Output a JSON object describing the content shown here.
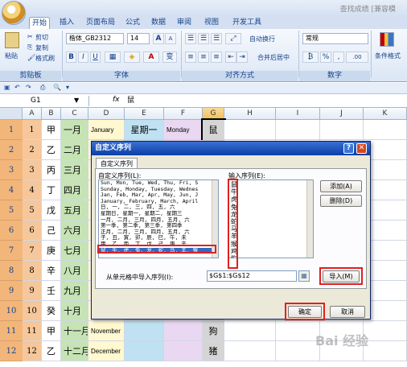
{
  "window": {
    "title": "查找成绩 [兼容模"
  },
  "tabs": [
    {
      "label": "开始",
      "active": true
    },
    {
      "label": "插入"
    },
    {
      "label": "页面布局"
    },
    {
      "label": "公式"
    },
    {
      "label": "数据"
    },
    {
      "label": "审阅"
    },
    {
      "label": "视图"
    },
    {
      "label": "开发工具"
    }
  ],
  "ribbon": {
    "clipboard": {
      "paste": "粘贴",
      "cut": "剪切",
      "copy": "复制",
      "format_painter": "格式刷",
      "label": "剪贴板"
    },
    "font": {
      "name": "楷体_GB2312",
      "size": "14",
      "grow": "A",
      "shrink": "A",
      "bold": "B",
      "italic": "I",
      "underline": "U",
      "wen": "变",
      "label": "字体"
    },
    "alignment": {
      "wrap": "自动换行",
      "merge": "合并后居中",
      "label": "对齐方式"
    },
    "number": {
      "format": "常规",
      "percent": "%",
      "comma": ",",
      "label": "数字"
    },
    "styles": {
      "cond": "条件格式"
    }
  },
  "formula_bar": {
    "name_box": "G1",
    "fx": "fx",
    "value": "鼠"
  },
  "columns": [
    "A",
    "B",
    "C",
    "D",
    "E",
    "F",
    "G",
    "H",
    "I",
    "J",
    "K"
  ],
  "rows": [
    {
      "n": "1",
      "B": "甲",
      "C": "一月",
      "D": "January",
      "E": "星期一",
      "F": "Monday",
      "G": "鼠"
    },
    {
      "n": "2",
      "B": "乙",
      "C": "二月",
      "D": "",
      "E": "",
      "F": "",
      "G": ""
    },
    {
      "n": "3",
      "B": "丙",
      "C": "三月",
      "D": "",
      "E": "",
      "F": "",
      "G": ""
    },
    {
      "n": "4",
      "B": "丁",
      "C": "四月",
      "D": "",
      "E": "",
      "F": "",
      "G": ""
    },
    {
      "n": "5",
      "B": "戊",
      "C": "五月",
      "D": "",
      "E": "",
      "F": "",
      "G": ""
    },
    {
      "n": "6",
      "B": "己",
      "C": "六月",
      "D": "",
      "E": "",
      "F": "",
      "G": ""
    },
    {
      "n": "7",
      "B": "庚",
      "C": "七月",
      "D": "",
      "E": "",
      "F": "",
      "G": ""
    },
    {
      "n": "8",
      "B": "辛",
      "C": "八月",
      "D": "",
      "E": "",
      "F": "",
      "G": ""
    },
    {
      "n": "9",
      "B": "壬",
      "C": "九月",
      "D": "",
      "E": "",
      "F": "",
      "G": ""
    },
    {
      "n": "10",
      "B": "癸",
      "C": "十月",
      "D": "",
      "E": "",
      "F": "",
      "G": ""
    },
    {
      "n": "11",
      "B": "甲",
      "C": "十一月",
      "D": "November",
      "E": "",
      "F": "",
      "G": "狗"
    },
    {
      "n": "12",
      "B": "乙",
      "C": "十二月",
      "D": "December",
      "E": "",
      "F": "",
      "G": "猪"
    }
  ],
  "dialog": {
    "title": "自定义序列",
    "tab": "自定义序列",
    "list_label": "自定义序列(L):",
    "entries_label": "输入序列(E):",
    "lists": [
      "Sun, Mon, Tue, Wed, Thu, Fri, S",
      "Sunday, Monday, Tuesday, Wednes",
      "Jan, Feb, Mar, Apr, May, Jun, J",
      "January, February, March, April",
      "日, 一, 二, 三, 四, 五, 六",
      "星期日, 星期一, 星期二, 星期三",
      "一月, 二月, 三月, 四月, 五月, 六",
      "第一季, 第二季, 第三季, 第四季",
      "正月, 二月, 三月, 四月, 五月, 六",
      "子, 丑, 寅, 卯, 辰, 巳, 午, 未",
      "甲, 乙, 丙, 丁, 戊, 己, 庚, 辛",
      "鼠, 牛, 虎, 兔, 龙, 蛇, 马, 羊, 猴"
    ],
    "entries": [
      "鼠",
      "牛",
      "虎",
      "兔",
      "龙",
      "蛇",
      "马",
      "羊",
      "猴",
      "鸡",
      "狗",
      "猪"
    ],
    "add": "添加(A)",
    "delete": "删除(D)",
    "import_label": "从单元格中导入序列(I):",
    "import_range": "$G$1:$G$12",
    "import": "导入(M)",
    "ok": "确定",
    "cancel": "取消"
  },
  "watermark": "Bai 经验"
}
